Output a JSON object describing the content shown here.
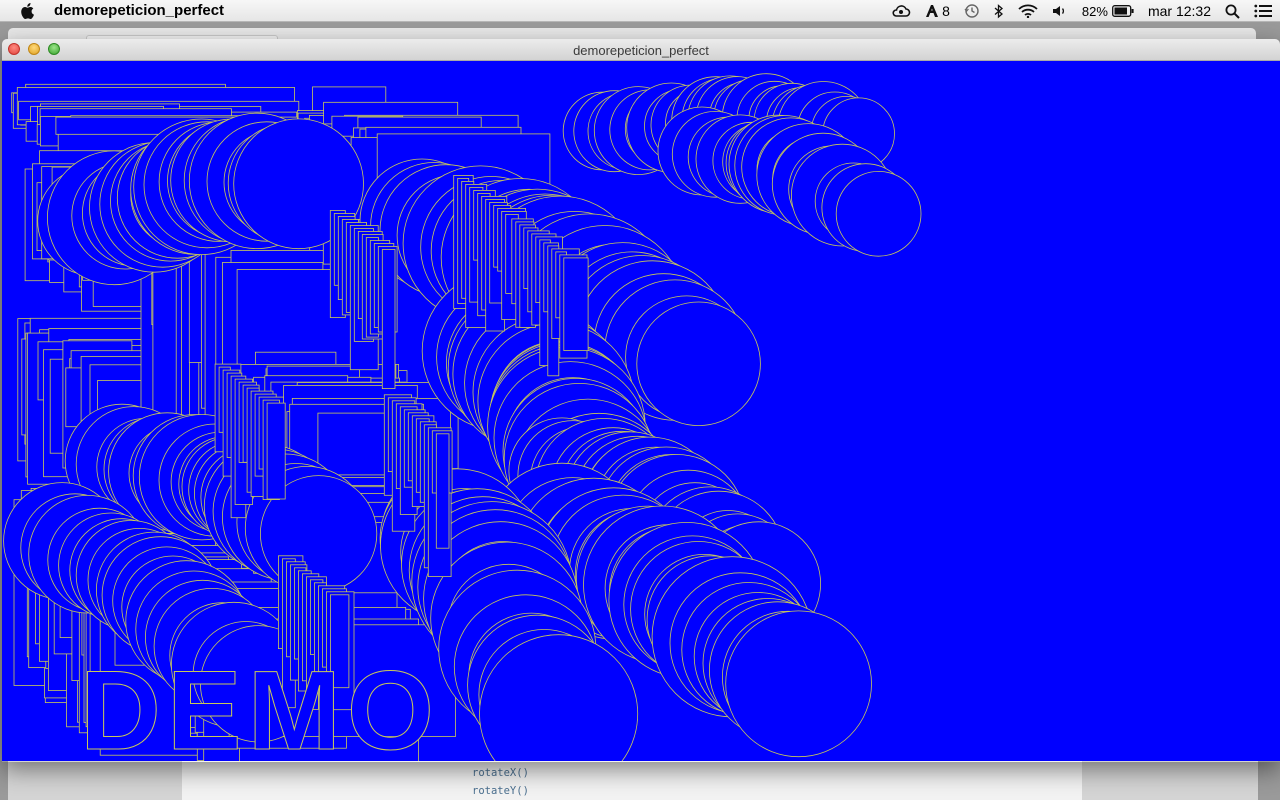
{
  "menubar": {
    "app_name": "demorepeticion_perfect",
    "status": {
      "adobe_badge": "8",
      "battery": "82%",
      "clock": "mar 12:32"
    }
  },
  "window": {
    "title": "demorepeticion_perfect"
  },
  "background_editor": {
    "code_lines": [
      "rotateX()",
      "rotateY()"
    ]
  },
  "canvas": {
    "background_color": "#0000FF",
    "stroke_color": "#C8C85A",
    "text": "DEMO"
  }
}
